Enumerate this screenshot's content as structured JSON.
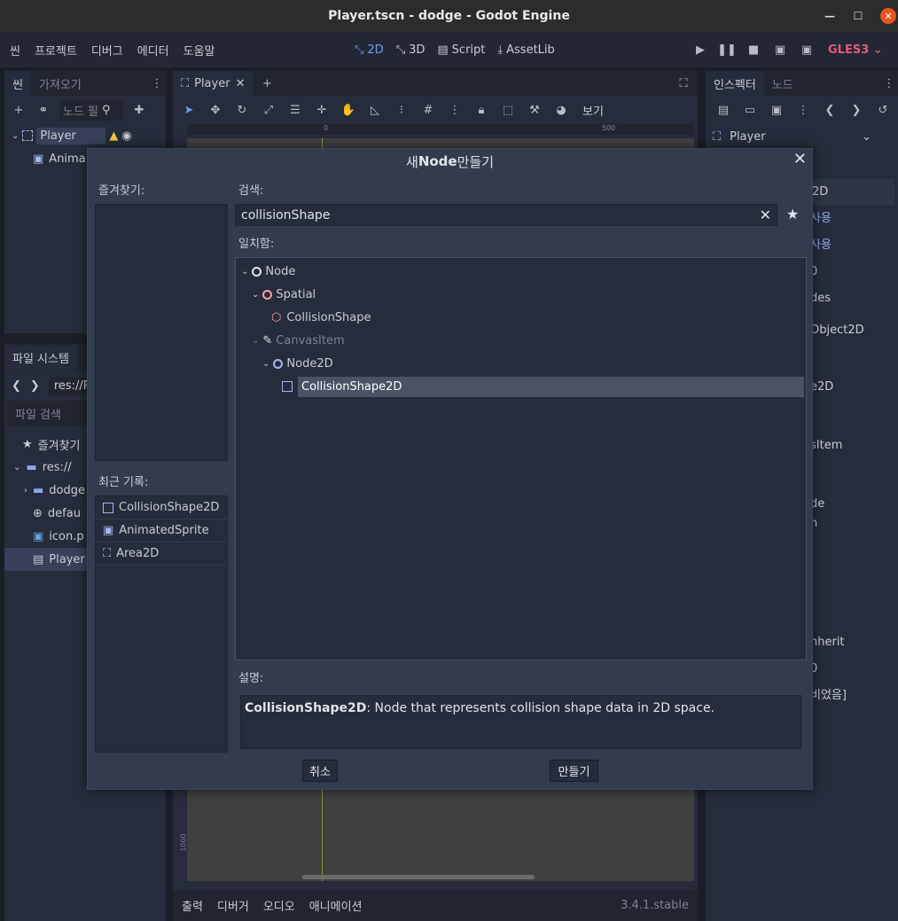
{
  "window": {
    "title": "Player.tscn - dodge - Godot Engine"
  },
  "menus": [
    "씬",
    "프로젝트",
    "디버그",
    "에디터",
    "도움말"
  ],
  "modes": [
    {
      "label": "2D"
    },
    {
      "label": "3D"
    },
    {
      "label": "Script"
    },
    {
      "label": "AssetLib"
    }
  ],
  "renderer": "GLES3",
  "scene_panel": {
    "tab_scene": "씬",
    "tab_import": "가져오기",
    "filter_placeholder": "노드 필",
    "nodes": [
      {
        "label": "Player"
      },
      {
        "label": "Anima"
      }
    ]
  },
  "fs_panel": {
    "tab": "파일 시스템",
    "path": "res://P",
    "search_placeholder": "파일 검색",
    "items": [
      {
        "label": "즐겨찾기"
      },
      {
        "label": "res://"
      },
      {
        "label": "dodge"
      },
      {
        "label": "defau"
      },
      {
        "label": "icon.p"
      },
      {
        "label": "Player"
      }
    ]
  },
  "editor": {
    "tab_label": "Player",
    "view_label": "보기",
    "ruler": [
      "0",
      "500"
    ],
    "vruler": "1000"
  },
  "bottom": {
    "tabs": [
      "출력",
      "디버거",
      "오디오",
      "애니메이션"
    ],
    "version": "3.4.1.stable"
  },
  "inspector": {
    "tab_inspector": "인스펙터",
    "tab_node": "노드",
    "object": "Player",
    "rows": [
      "2D",
      "사용",
      "사용",
      "0",
      "des",
      "Object2D",
      "e2D",
      "sItem",
      "de",
      "n",
      "nherit",
      "0",
      "비었음]"
    ]
  },
  "dialog": {
    "title_pre": "새 ",
    "title_bold": "Node",
    "title_post": " 만들기",
    "favorites_label": "즐겨찾기:",
    "recent_label": "최근 기록:",
    "recent": [
      {
        "label": "CollisionShape2D"
      },
      {
        "label": "AnimatedSprite"
      },
      {
        "label": "Area2D"
      }
    ],
    "search_label": "검색:",
    "search_value": "collisionShape",
    "matches_label": "일치함:",
    "tree": [
      {
        "label": "Node"
      },
      {
        "label": "Spatial"
      },
      {
        "label": "CollisionShape"
      },
      {
        "label": "CanvasItem"
      },
      {
        "label": "Node2D"
      },
      {
        "label": "CollisionShape2D"
      }
    ],
    "description_label": "설명:",
    "description_name": "CollisionShape2D",
    "description_text": ": Node that represents collision shape data in 2D space.",
    "cancel": "취소",
    "create": "만들기"
  }
}
